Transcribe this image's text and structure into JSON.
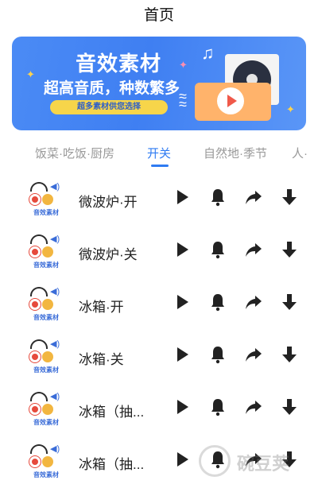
{
  "page": {
    "title": "首页"
  },
  "banner": {
    "title": "音效素材",
    "subtitle": "超高音质，种数繁多",
    "pill": "超多素材供您选择"
  },
  "tabs": [
    {
      "label": "饭菜·吃饭·厨房",
      "active": false
    },
    {
      "label": "开关",
      "active": true
    },
    {
      "label": "自然地·季节",
      "active": false
    },
    {
      "label": "人·",
      "active": false
    }
  ],
  "thumb_label": "音效素材",
  "sounds": [
    {
      "name": "微波炉·开"
    },
    {
      "name": "微波炉·关"
    },
    {
      "name": "冰箱·开"
    },
    {
      "name": "冰箱·关"
    },
    {
      "name": "冰箱（抽..."
    },
    {
      "name": "冰箱（抽..."
    }
  ],
  "icons": {
    "play": "play-icon",
    "ringtone": "bell-icon",
    "share": "share-arrow-icon",
    "download": "download-icon"
  },
  "watermark": {
    "text": "碗豆荚"
  },
  "colors": {
    "accent": "#2f7bf2",
    "banner": "#4b8bf5",
    "icon": "#222222"
  }
}
